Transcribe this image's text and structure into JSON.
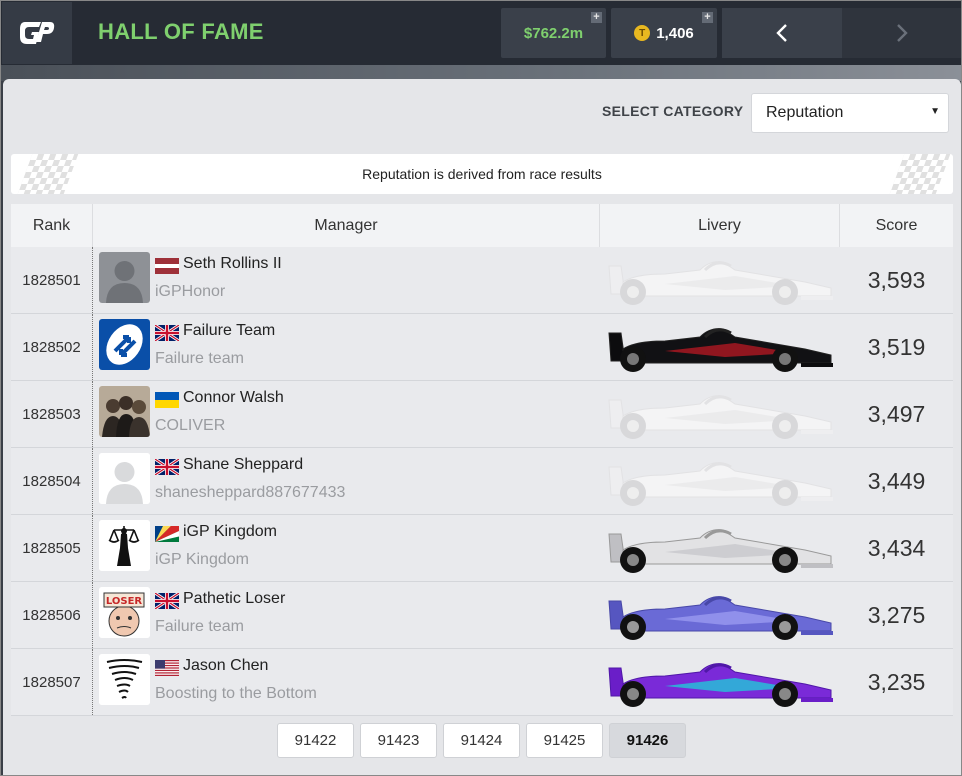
{
  "header": {
    "title": "HALL OF FAME",
    "money": "$762.2m",
    "tokens": "1,406",
    "token_symbol": "T",
    "plus_symbol": "+",
    "prev_icon": "chevron-left-icon",
    "next_icon": "chevron-right-icon"
  },
  "category": {
    "label": "SELECT CATEGORY",
    "selected": "Reputation"
  },
  "banner": {
    "text": "Reputation is derived from race results"
  },
  "table": {
    "columns": [
      "Rank",
      "Manager",
      "Livery",
      "Score"
    ],
    "rows": [
      {
        "rank": "1828501",
        "manager": "Seth Rollins II",
        "team": "iGPHonor",
        "score": "3,593",
        "flag": "latvia",
        "avatar": "default-avatar",
        "livery": "blank"
      },
      {
        "rank": "1828502",
        "manager": "Failure Team",
        "team": "Failure team",
        "score": "3,519",
        "flag": "uk",
        "avatar": "uno-reverse",
        "livery": "black-red"
      },
      {
        "rank": "1828503",
        "manager": "Connor Walsh",
        "team": "COLIVER",
        "score": "3,497",
        "flag": "ukraine",
        "avatar": "photo",
        "livery": "blank"
      },
      {
        "rank": "1828504",
        "manager": "Shane Sheppard",
        "team": "shanesheppard887677433",
        "score": "3,449",
        "flag": "uk",
        "avatar": "default-avatar-light",
        "livery": "blank"
      },
      {
        "rank": "1828505",
        "manager": "iGP Kingdom",
        "team": "iGP Kingdom",
        "score": "3,434",
        "flag": "seychelles",
        "avatar": "justice",
        "livery": "silver"
      },
      {
        "rank": "1828506",
        "manager": "Pathetic Loser",
        "team": "Failure team",
        "score": "3,275",
        "flag": "uk",
        "avatar": "loser-sign",
        "livery": "purple"
      },
      {
        "rank": "1828507",
        "manager": "Jason Chen",
        "team": "Boosting to the Bottom",
        "score": "3,235",
        "flag": "usa",
        "avatar": "tornado",
        "livery": "cyan-purple"
      }
    ]
  },
  "avatar_text": {
    "loser": "LOSER"
  },
  "pagination": [
    "91422",
    "91423",
    "91424",
    "91425",
    "91426"
  ],
  "pagination_active": "91426",
  "colors": {
    "accent_green": "#7fd06e",
    "topbar": "#262b34",
    "panel": "#e5e6e9"
  }
}
